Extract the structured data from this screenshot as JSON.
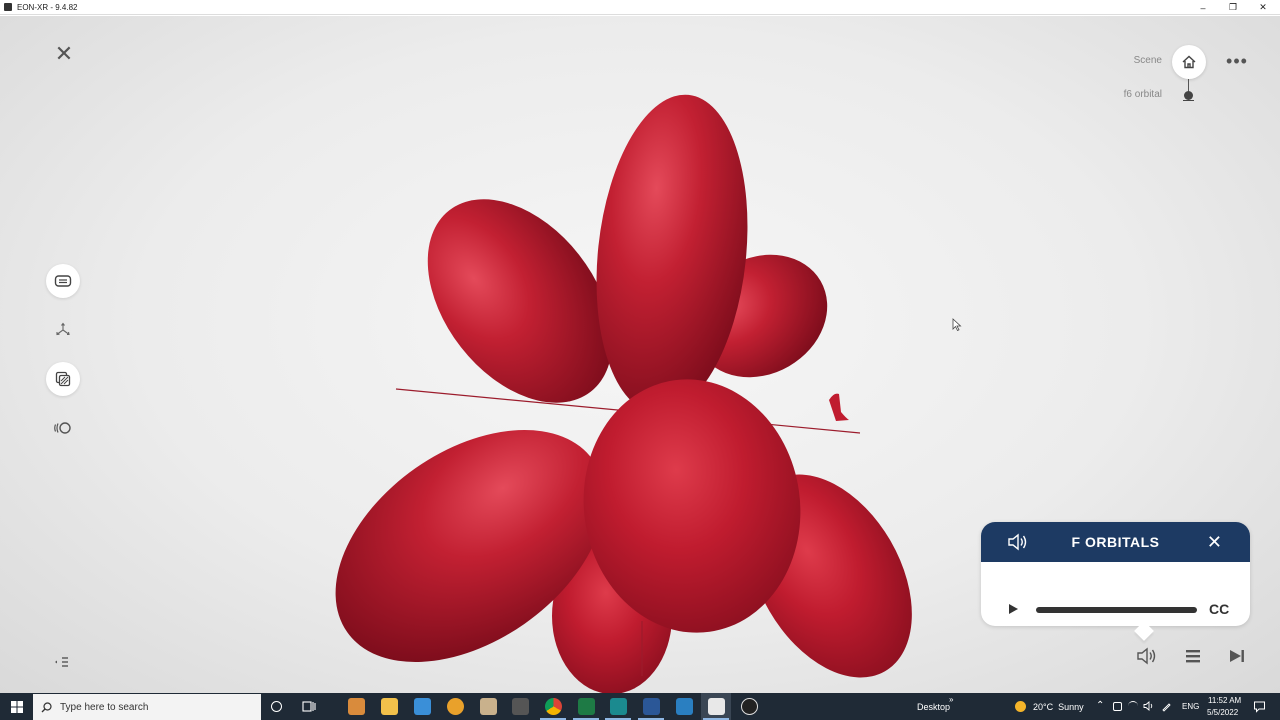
{
  "window": {
    "title": "EON-XR - 9.4.82"
  },
  "scene": {
    "scene_label": "Scene",
    "object_label": "f6 orbital",
    "model_color": "#b3192e"
  },
  "audio_panel": {
    "title": "F ORBITALS",
    "cc_label": "CC",
    "header_color": "#1d3a63",
    "progress": 0
  },
  "taskbar": {
    "search_placeholder": "Type here to search",
    "desktop_label": "Desktop",
    "weather": "20°C  Sunny",
    "language": "ENG",
    "time": "11:52 AM",
    "date": "5/5/2022",
    "apps": [
      "cortana-icon",
      "task-view-icon",
      "app-icon",
      "file-explorer-icon",
      "app-icon",
      "app-icon",
      "app-icon",
      "app-icon",
      "chrome-icon",
      "excel-icon",
      "app-icon",
      "word-icon",
      "app-icon",
      "eon-xr-icon",
      "app-icon"
    ]
  }
}
